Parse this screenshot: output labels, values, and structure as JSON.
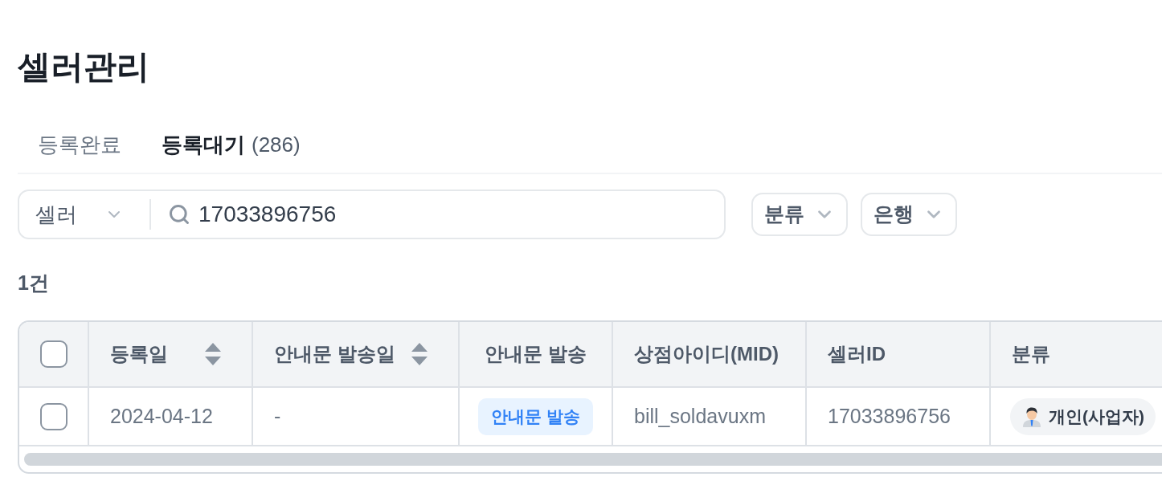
{
  "page": {
    "title": "셀러관리"
  },
  "tabs": [
    {
      "label": "등록완료",
      "selected": false
    },
    {
      "label": "등록대기",
      "count": "(286)",
      "selected": true
    }
  ],
  "search": {
    "scope": "셀러",
    "value": "17033896756"
  },
  "filters": [
    {
      "label": "분류"
    },
    {
      "label": "은행"
    }
  ],
  "result_count": "1건",
  "table": {
    "select_all": {
      "checked": false
    },
    "columns": [
      {
        "label": "등록일",
        "sortable": true
      },
      {
        "label": "안내문 발송일",
        "sortable": true
      },
      {
        "label": "안내문 발송",
        "sortable": false
      },
      {
        "label": "상점아이디(MID)",
        "sortable": false
      },
      {
        "label": "셀러ID",
        "sortable": false
      },
      {
        "label": "분류",
        "sortable": false
      }
    ],
    "rows": [
      {
        "checked": false,
        "cells": [
          {
            "kind": "text",
            "text": "2024-04-12"
          },
          {
            "kind": "text",
            "text": "-"
          },
          {
            "kind": "button",
            "text": "안내문 발송"
          },
          {
            "kind": "text",
            "text": "bill_soldavuxm"
          },
          {
            "kind": "text",
            "text": "17033896756"
          },
          {
            "kind": "tag",
            "text": "개인(사업자)"
          }
        ]
      }
    ]
  }
}
